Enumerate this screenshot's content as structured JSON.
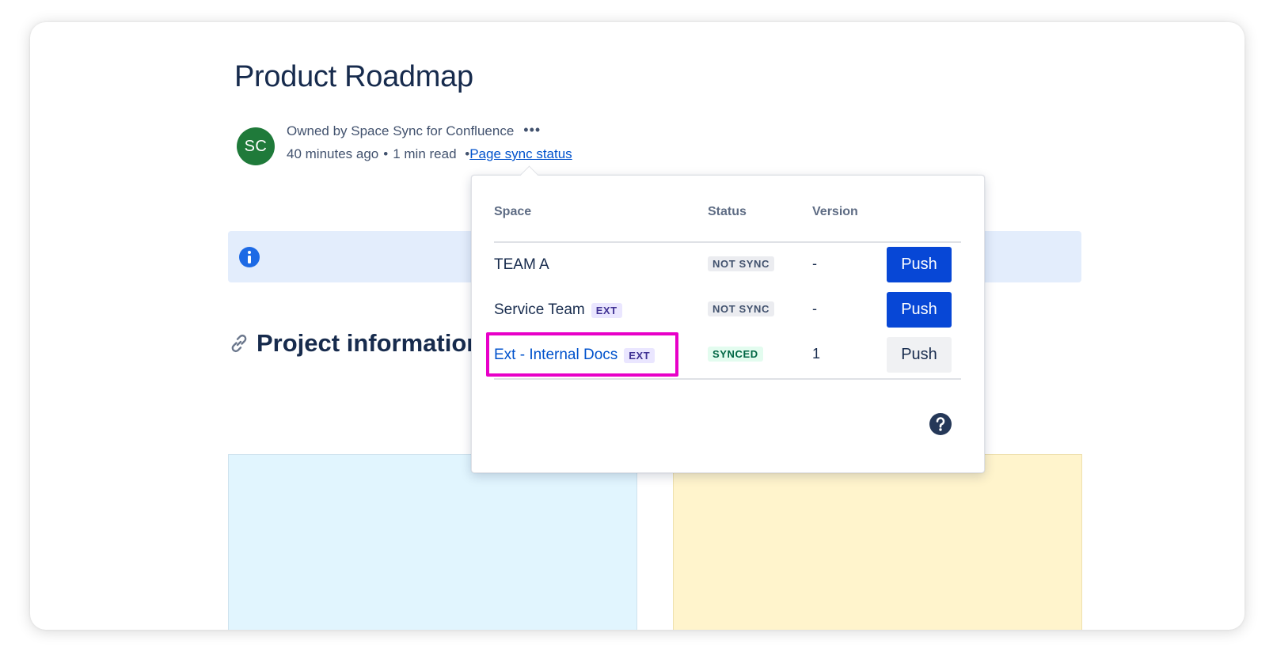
{
  "page": {
    "title": "Product Roadmap",
    "avatar_initials": "SC",
    "owner_text": "Owned by Space Sync for Confluence",
    "more_icon": "more-icon",
    "time_ago": "40 minutes ago",
    "read_time": "1 min read",
    "separator": "•",
    "sync_status_link": "Page sync status",
    "section_heading": "Project information"
  },
  "popup": {
    "columns": {
      "space": "Space",
      "status": "Status",
      "version": "Version"
    },
    "rows": [
      {
        "space": "TEAM A",
        "ext": "",
        "status": "NOT SYNC",
        "version": "-",
        "push": "Push"
      },
      {
        "space": "Service Team",
        "ext": "EXT",
        "status": "NOT SYNC",
        "version": "-",
        "push": "Push"
      },
      {
        "space": "Ext - Internal Docs",
        "ext": "EXT",
        "status": "SYNCED",
        "version": "1",
        "push": "Push"
      }
    ],
    "help_icon": "help-icon"
  },
  "colors": {
    "primary_button": "#0747d6",
    "highlight": "#e800c8",
    "avatar": "#1f7a3a",
    "link": "#0052cc"
  }
}
